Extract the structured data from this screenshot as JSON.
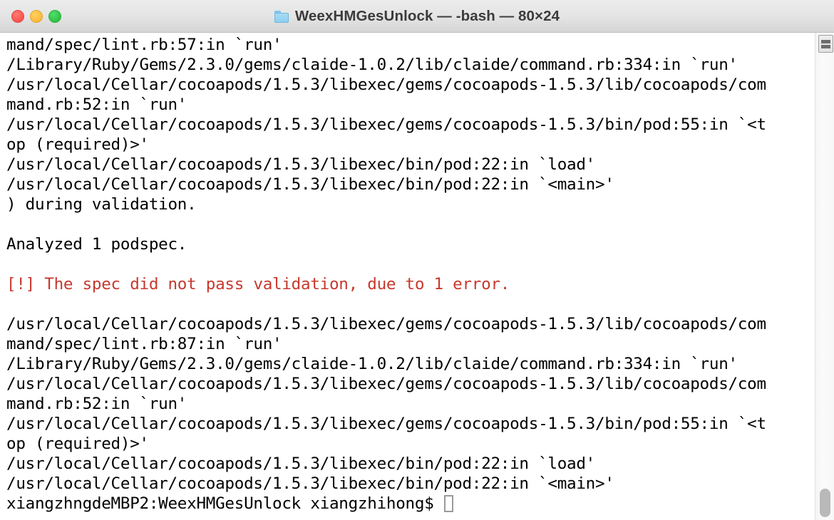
{
  "window": {
    "title": "WeexHMGesUnlock — -bash — 80×24",
    "folder_icon": "folder-icon",
    "traffic_lights": [
      {
        "name": "close",
        "color": "#fc5753"
      },
      {
        "name": "minimize",
        "color": "#fdbc40"
      },
      {
        "name": "maximize",
        "color": "#33c748"
      }
    ]
  },
  "terminal": {
    "columns": 80,
    "rows": 24,
    "error_color": "#c7392e",
    "text_color": "#000000",
    "background": "#ffffff",
    "lines": [
      {
        "text": "mand/spec/lint.rb:57:in `run'",
        "style": "normal"
      },
      {
        "text": "/Library/Ruby/Gems/2.3.0/gems/claide-1.0.2/lib/claide/command.rb:334:in `run'",
        "style": "normal"
      },
      {
        "text": "/usr/local/Cellar/cocoapods/1.5.3/libexec/gems/cocoapods-1.5.3/lib/cocoapods/com",
        "style": "normal"
      },
      {
        "text": "mand.rb:52:in `run'",
        "style": "normal"
      },
      {
        "text": "/usr/local/Cellar/cocoapods/1.5.3/libexec/gems/cocoapods-1.5.3/bin/pod:55:in `<t",
        "style": "normal"
      },
      {
        "text": "op (required)>'",
        "style": "normal"
      },
      {
        "text": "/usr/local/Cellar/cocoapods/1.5.3/libexec/bin/pod:22:in `load'",
        "style": "normal"
      },
      {
        "text": "/usr/local/Cellar/cocoapods/1.5.3/libexec/bin/pod:22:in `<main>'",
        "style": "normal"
      },
      {
        "text": ") during validation.",
        "style": "normal"
      },
      {
        "text": "",
        "style": "normal"
      },
      {
        "text": "Analyzed 1 podspec.",
        "style": "normal"
      },
      {
        "text": "",
        "style": "normal"
      },
      {
        "text": "[!] The spec did not pass validation, due to 1 error.",
        "style": "error"
      },
      {
        "text": "",
        "style": "normal"
      },
      {
        "text": "/usr/local/Cellar/cocoapods/1.5.3/libexec/gems/cocoapods-1.5.3/lib/cocoapods/com",
        "style": "normal"
      },
      {
        "text": "mand/spec/lint.rb:87:in `run'",
        "style": "normal"
      },
      {
        "text": "/Library/Ruby/Gems/2.3.0/gems/claide-1.0.2/lib/claide/command.rb:334:in `run'",
        "style": "normal"
      },
      {
        "text": "/usr/local/Cellar/cocoapods/1.5.3/libexec/gems/cocoapods-1.5.3/lib/cocoapods/com",
        "style": "normal"
      },
      {
        "text": "mand.rb:52:in `run'",
        "style": "normal"
      },
      {
        "text": "/usr/local/Cellar/cocoapods/1.5.3/libexec/gems/cocoapods-1.5.3/bin/pod:55:in `<t",
        "style": "normal"
      },
      {
        "text": "op (required)>'",
        "style": "normal"
      },
      {
        "text": "/usr/local/Cellar/cocoapods/1.5.3/libexec/bin/pod:22:in `load'",
        "style": "normal"
      },
      {
        "text": "/usr/local/Cellar/cocoapods/1.5.3/libexec/bin/pod:22:in `<main>'",
        "style": "normal"
      }
    ],
    "prompt": "xiangzhngdeMBP2:WeexHMGesUnlock xiangzhihong$ ",
    "command_input": ""
  },
  "gutter": {
    "split_pane_icon": "split-pane-icon",
    "scrollbar": {
      "thumb_position": "bottom"
    }
  }
}
